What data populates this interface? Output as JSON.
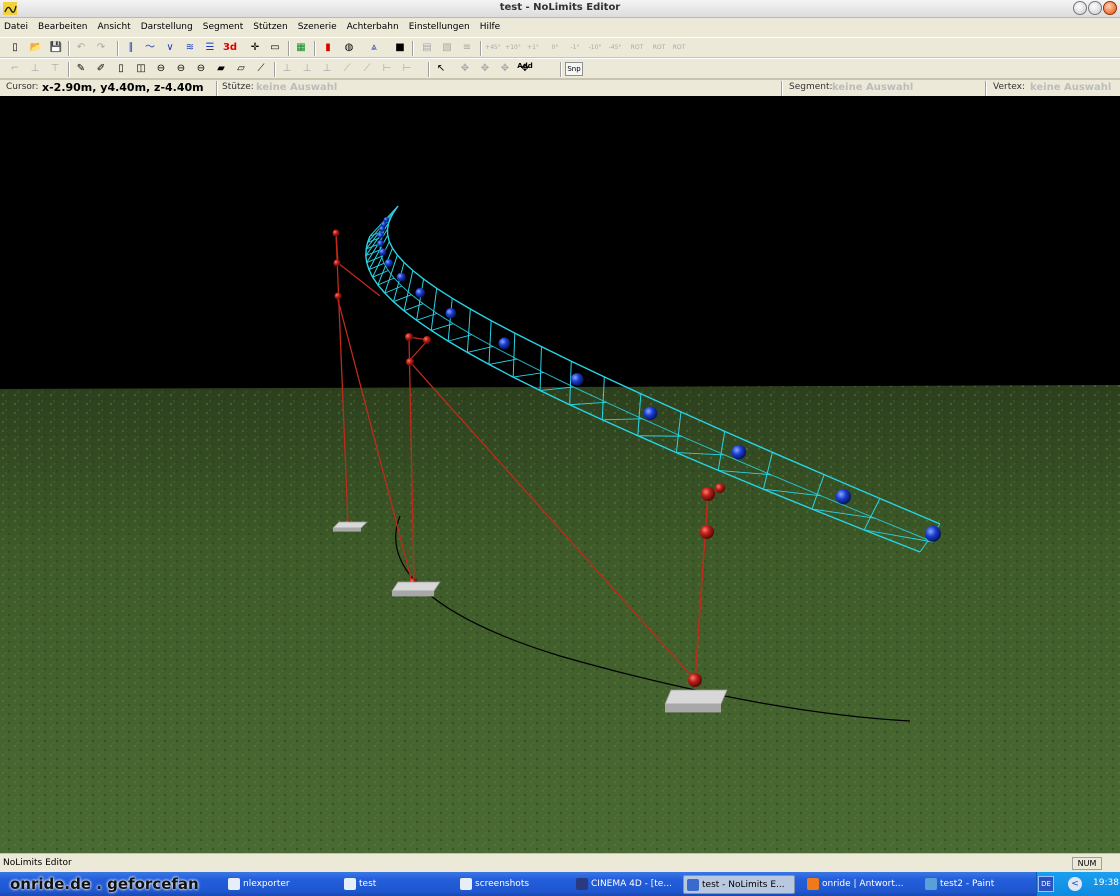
{
  "window": {
    "title": "test - NoLimits Editor"
  },
  "menu": [
    "Datei",
    "Bearbeiten",
    "Ansicht",
    "Darstellung",
    "Segment",
    "Stützen",
    "Szenerie",
    "Achterbahn",
    "Einstellungen",
    "Hilfe"
  ],
  "toolbar": {
    "row1": [
      {
        "name": "new-icon",
        "glyph": "▯",
        "enabled": true
      },
      {
        "name": "open-folder-icon",
        "glyph": "📂",
        "enabled": true
      },
      {
        "name": "save-icon",
        "glyph": "💾",
        "enabled": true
      },
      {
        "name": "undo-icon",
        "glyph": "↶",
        "enabled": false
      },
      {
        "name": "redo-icon",
        "glyph": "↷",
        "enabled": false
      },
      {
        "name": "track-view-icon",
        "glyph": "∥",
        "enabled": true
      },
      {
        "name": "curve-icon",
        "glyph": "〜",
        "enabled": true
      },
      {
        "name": "dip-icon",
        "glyph": "∨",
        "enabled": true
      },
      {
        "name": "train-icon",
        "glyph": "≋",
        "enabled": true
      },
      {
        "name": "station-icon",
        "glyph": "☰",
        "enabled": true
      },
      {
        "name": "3d-view-icon",
        "glyph": "3d",
        "enabled": true
      },
      {
        "name": "insert-vertex-icon",
        "glyph": "✛",
        "enabled": true
      },
      {
        "name": "delete-vertex-icon",
        "glyph": "▭",
        "enabled": true
      },
      {
        "name": "grid-icon",
        "glyph": "▦",
        "enabled": true
      },
      {
        "name": "traffic-light-icon",
        "glyph": "▮",
        "enabled": true
      },
      {
        "name": "globe-icon",
        "glyph": "◍",
        "enabled": true
      },
      {
        "name": "structure-icon",
        "glyph": "⩓",
        "enabled": true
      },
      {
        "name": "block-icon",
        "glyph": "■",
        "enabled": true
      },
      {
        "name": "table-icon",
        "glyph": "▤",
        "enabled": false
      },
      {
        "name": "film-icon",
        "glyph": "▧",
        "enabled": false
      },
      {
        "name": "align-icon",
        "glyph": "≡",
        "enabled": false
      }
    ],
    "row1_labels": [
      "+45°",
      "+10°",
      "+1°",
      "0°",
      "-1°",
      "-10°",
      "-45°",
      "ROT",
      "ROT",
      "ROT"
    ],
    "row2": [
      {
        "name": "support-a-icon",
        "glyph": "⌐",
        "enabled": false
      },
      {
        "name": "support-b-icon",
        "glyph": "⊥",
        "enabled": false
      },
      {
        "name": "support-c-icon",
        "glyph": "⊤",
        "enabled": false
      },
      {
        "name": "pencil-icon",
        "glyph": "✎",
        "enabled": true
      },
      {
        "name": "pencil-double-icon",
        "glyph": "✐",
        "enabled": true
      },
      {
        "name": "pillar-icon",
        "glyph": "▯",
        "enabled": true
      },
      {
        "name": "cylinder-icon",
        "glyph": "◫",
        "enabled": true
      },
      {
        "name": "cylinder-b-icon",
        "glyph": "⊖",
        "enabled": true
      },
      {
        "name": "cylinder-c-icon",
        "glyph": "⊖",
        "enabled": true
      },
      {
        "name": "cylinder-d-icon",
        "glyph": "⊖",
        "enabled": true
      },
      {
        "name": "footer-icon",
        "glyph": "▰",
        "enabled": true
      },
      {
        "name": "beam-icon",
        "glyph": "▱",
        "enabled": true
      },
      {
        "name": "connector-icon",
        "glyph": "⟋",
        "enabled": true
      },
      {
        "name": "support-d-icon",
        "glyph": "⊥",
        "enabled": false
      },
      {
        "name": "support-e-icon",
        "glyph": "⊥",
        "enabled": false
      },
      {
        "name": "support-f-icon",
        "glyph": "⊥",
        "enabled": false
      },
      {
        "name": "support-g-icon",
        "glyph": "⟋",
        "enabled": false
      },
      {
        "name": "support-h-icon",
        "glyph": "⟋",
        "enabled": false
      },
      {
        "name": "support-i-icon",
        "glyph": "⊢",
        "enabled": false
      },
      {
        "name": "support-j-icon",
        "glyph": "⊢",
        "enabled": false
      },
      {
        "name": "select-arrow-icon",
        "glyph": "↖",
        "enabled": true
      },
      {
        "name": "add-a-icon",
        "glyph": "✥",
        "enabled": false
      },
      {
        "name": "add-b-icon",
        "glyph": "✥",
        "enabled": false
      },
      {
        "name": "add-c-icon",
        "glyph": "✥",
        "enabled": false
      },
      {
        "name": "add-d-icon",
        "glyph": "✥",
        "enabled": true
      }
    ],
    "add_label": "Add",
    "snap_label": "Snp"
  },
  "infobar": {
    "cursor_label": "Cursor:",
    "cursor_value": "x-2.90m, y4.40m, z-4.40m",
    "stuetze_label": "Stütze:",
    "stuetze_value": "keine Auswahl",
    "segment_label": "Segment:",
    "segment_value": "keine Auswahl",
    "vertex_label": "Vertex:",
    "vertex_value": "keine Auswahl"
  },
  "statusbar": {
    "left": "NoLimits Editor",
    "num": "NUM"
  },
  "taskbar": {
    "watermark": "onride.de . geforcefan",
    "tasks": [
      {
        "label": "nlexporter",
        "active": false
      },
      {
        "label": "test",
        "active": false
      },
      {
        "label": "screenshots",
        "active": false
      },
      {
        "label": "CINEMA 4D - [te...",
        "active": false
      },
      {
        "label": "test - NoLimits E...",
        "active": true
      },
      {
        "label": "onride | Antwort...",
        "active": false
      },
      {
        "label": "test2 - Paint",
        "active": false
      }
    ],
    "language": "DE",
    "tray_arrow": "<",
    "clock": "19:38"
  },
  "colors": {
    "track": "#27d4e6",
    "vertex": "#1533c8",
    "support": "#c02a1a",
    "sky": "#000000",
    "ground": "#3f5c2a"
  }
}
